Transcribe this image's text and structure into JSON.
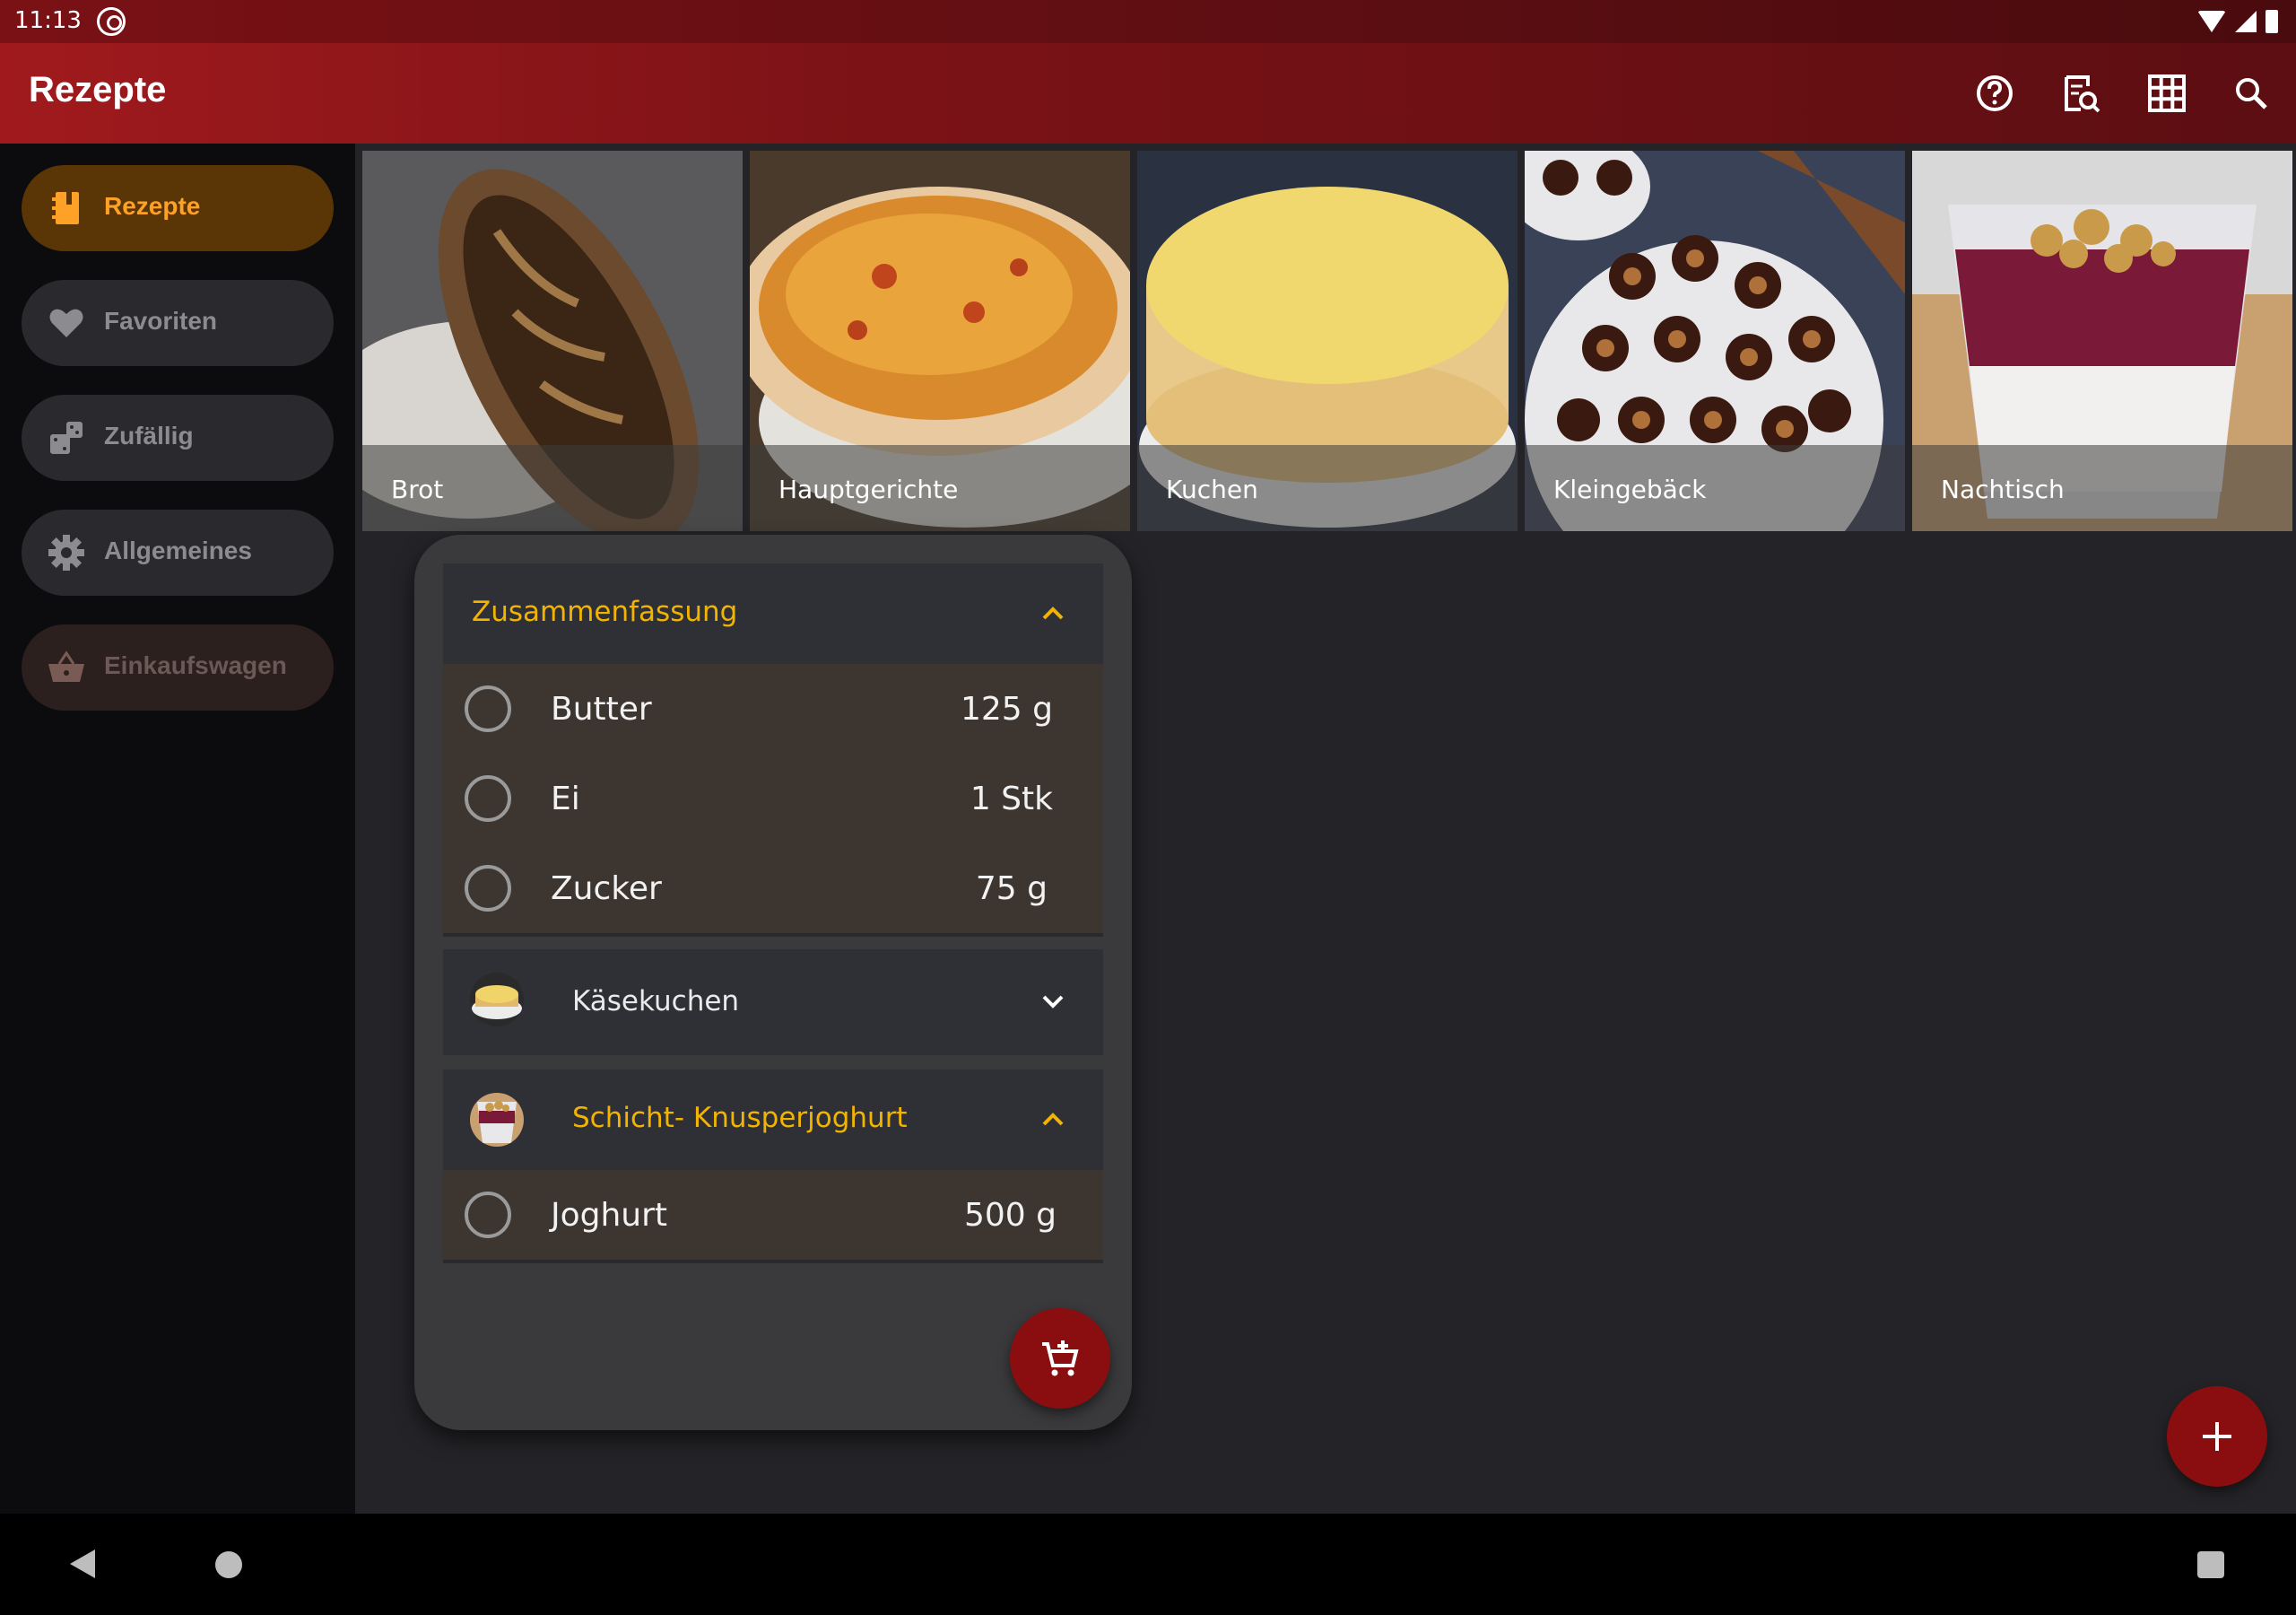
{
  "status_bar": {
    "time": "11:13"
  },
  "app_bar": {
    "title": "Rezepte",
    "icons": [
      "help-icon",
      "recipe-search-icon",
      "grid-icon",
      "search-icon"
    ]
  },
  "sidebar": {
    "items": [
      {
        "label": "Rezepte",
        "icon": "recipe-book-icon",
        "active": true
      },
      {
        "label": "Favoriten",
        "icon": "heart-icon"
      },
      {
        "label": "Zufällig",
        "icon": "dice-icon"
      },
      {
        "label": "Allgemeines",
        "icon": "gear-icon"
      },
      {
        "label": "Einkaufswagen",
        "icon": "basket-icon"
      }
    ]
  },
  "categories": [
    {
      "label": "Brot"
    },
    {
      "label": "Hauptgerichte"
    },
    {
      "label": "Kuchen"
    },
    {
      "label": "Kleingebäck"
    },
    {
      "label": "Nachtisch"
    }
  ],
  "shopping": {
    "sections": [
      {
        "title": "Zusammenfassung",
        "expanded": true,
        "items": [
          {
            "name": "Butter",
            "qty": "125 g"
          },
          {
            "name": "Ei",
            "qty": "1 Stk"
          },
          {
            "name": "Zucker",
            "qty": "75 g"
          }
        ]
      },
      {
        "title": "Käsekuchen",
        "expanded": false,
        "items": []
      },
      {
        "title": "Schicht- Knusperjoghurt",
        "expanded": true,
        "items": [
          {
            "name": "Joghurt",
            "qty": "500 g"
          }
        ]
      }
    ]
  },
  "colors": {
    "accent": "#ffa126",
    "gold": "#f2b400",
    "brand_red": "#8a0e0f"
  }
}
